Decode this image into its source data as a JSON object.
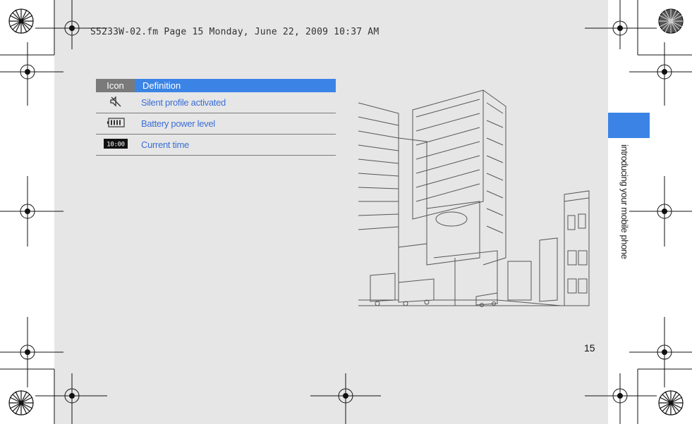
{
  "header": {
    "slug": "S5233W-02.fm  Page 15  Monday, June 22, 2009  10:37 AM"
  },
  "side_tab": {
    "label": "introducing your mobile phone"
  },
  "table": {
    "headers": {
      "icon": "Icon",
      "definition": "Definition"
    },
    "rows": [
      {
        "icon": "silent-profile-icon",
        "definition": "Silent profile activated"
      },
      {
        "icon": "battery-icon",
        "definition": "Battery power level"
      },
      {
        "icon": "clock-icon",
        "definition": "Current time",
        "icon_text": "10:00"
      }
    ]
  },
  "page_number": "15",
  "colors": {
    "accent": "#3b84e6",
    "header_gray": "#7a7a7a",
    "page_bg": "#e6e6e6",
    "link_text": "#3b6fd6"
  }
}
